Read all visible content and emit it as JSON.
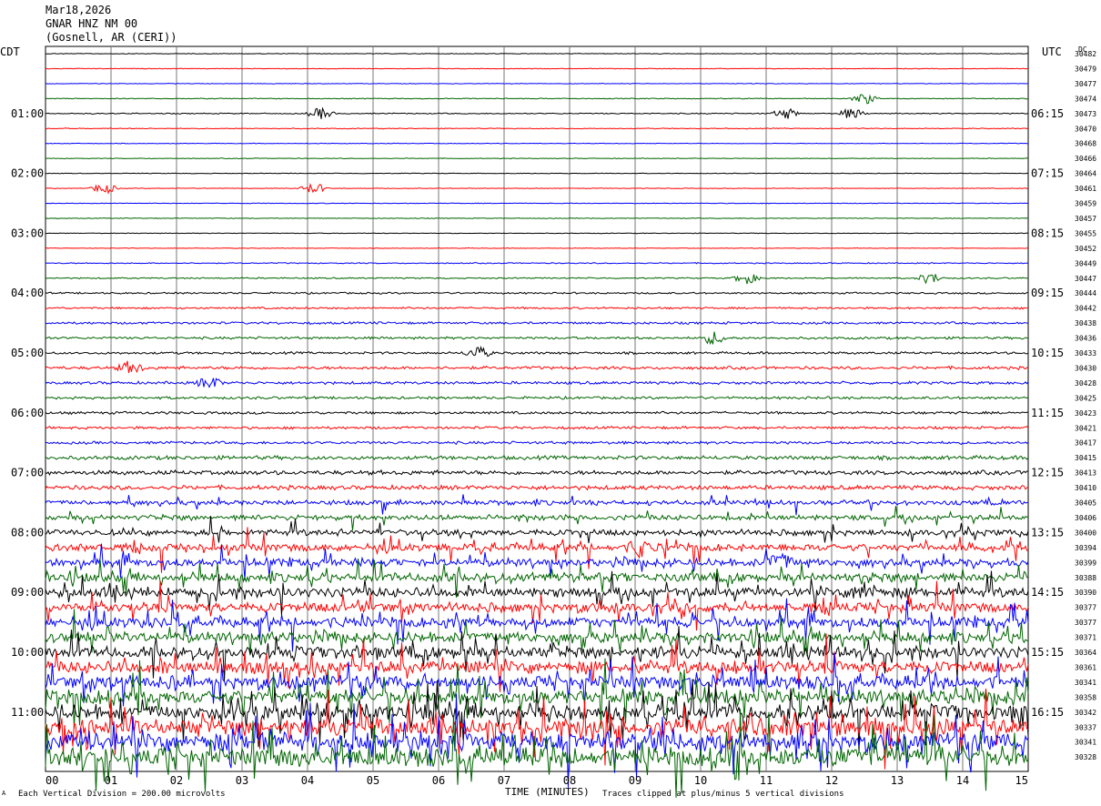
{
  "header": {
    "date": "Mar18,2026",
    "station": "GNAR HNZ NM 00",
    "location": "(Gosnell, AR (CERI))"
  },
  "left_label": "CDT",
  "right_label": "UTC",
  "dc_label": "DC",
  "footer": {
    "xlabel": "TIME (MINUTES)",
    "scale_note": "Each Vertical Division = 200.00 microvolts",
    "clip_note": "Traces clipped at plus/minus 5 vertical divisions",
    "corner_mark": "A"
  },
  "chart_data": {
    "type": "line",
    "plot_kind": "helicorder",
    "x_range_minutes": [
      0,
      15
    ],
    "x_ticks": [
      "00",
      "01",
      "02",
      "03",
      "04",
      "05",
      "06",
      "07",
      "08",
      "09",
      "10",
      "11",
      "12",
      "13",
      "14",
      "15"
    ],
    "trace_colors": [
      "#000000",
      "#ff0000",
      "#0000ff",
      "#006400"
    ],
    "trace_count": 48,
    "left_time_labels": [
      {
        "trace": 4,
        "label": "01:00"
      },
      {
        "trace": 8,
        "label": "02:00"
      },
      {
        "trace": 12,
        "label": "03:00"
      },
      {
        "trace": 16,
        "label": "04:00"
      },
      {
        "trace": 20,
        "label": "05:00"
      },
      {
        "trace": 24,
        "label": "06:00"
      },
      {
        "trace": 28,
        "label": "07:00"
      },
      {
        "trace": 32,
        "label": "08:00"
      },
      {
        "trace": 36,
        "label": "09:00"
      },
      {
        "trace": 40,
        "label": "10:00"
      },
      {
        "trace": 44,
        "label": "11:00"
      }
    ],
    "right_time_labels": [
      {
        "trace": 4,
        "label": "06:15"
      },
      {
        "trace": 8,
        "label": "07:15"
      },
      {
        "trace": 12,
        "label": "08:15"
      },
      {
        "trace": 16,
        "label": "09:15"
      },
      {
        "trace": 20,
        "label": "10:15"
      },
      {
        "trace": 24,
        "label": "11:15"
      },
      {
        "trace": 28,
        "label": "12:15"
      },
      {
        "trace": 32,
        "label": "13:15"
      },
      {
        "trace": 36,
        "label": "14:15"
      },
      {
        "trace": 40,
        "label": "15:15"
      },
      {
        "trace": 44,
        "label": "16:15"
      }
    ],
    "dc_offsets": [
      "30482",
      "30479",
      "30477",
      "30474",
      "30473",
      "30470",
      "30468",
      "30466",
      "30464",
      "30461",
      "30459",
      "30457",
      "30455",
      "30452",
      "30449",
      "30447",
      "30444",
      "30442",
      "30438",
      "30436",
      "30433",
      "30430",
      "30428",
      "30425",
      "30423",
      "30421",
      "30417",
      "30415",
      "30413",
      "30410",
      "30405",
      "30406",
      "30400",
      "30394",
      "30399",
      "30388",
      "30390",
      "30377",
      "30377",
      "30371",
      "30364",
      "30361",
      "30341",
      "30358",
      "30342",
      "30337",
      "30341",
      "30328"
    ],
    "trace_noise_level": [
      0.3,
      0.3,
      0.3,
      0.4,
      0.5,
      0.4,
      0.3,
      0.3,
      0.3,
      0.3,
      0.3,
      0.3,
      0.3,
      0.3,
      0.5,
      0.6,
      0.8,
      0.9,
      1.1,
      1.1,
      1.1,
      1.4,
      1.3,
      1.2,
      1.2,
      1.2,
      1.3,
      1.8,
      2.0,
      2.0,
      2.2,
      2.4,
      2.8,
      3.4,
      3.6,
      4.0,
      4.4,
      4.4,
      4.6,
      4.8,
      5.2,
      5.6,
      6.0,
      6.5,
      7.0,
      7.4,
      8.0,
      8.5
    ],
    "notable_events_minutes": [
      {
        "trace": 3,
        "minute": 12.5
      },
      {
        "trace": 4,
        "minute": 4.2
      },
      {
        "trace": 4,
        "minute": 11.3
      },
      {
        "trace": 4,
        "minute": 12.3
      },
      {
        "trace": 9,
        "minute": 0.9
      },
      {
        "trace": 9,
        "minute": 4.1
      },
      {
        "trace": 15,
        "minute": 10.7
      },
      {
        "trace": 15,
        "minute": 13.5
      },
      {
        "trace": 19,
        "minute": 10.2
      },
      {
        "trace": 20,
        "minute": 6.6
      },
      {
        "trace": 21,
        "minute": 1.3
      },
      {
        "trace": 22,
        "minute": 2.5
      },
      {
        "trace": 33,
        "minute": 9.1
      },
      {
        "trace": 34,
        "minute": 11.2
      },
      {
        "trace": 36,
        "minute": 12.5
      }
    ]
  }
}
